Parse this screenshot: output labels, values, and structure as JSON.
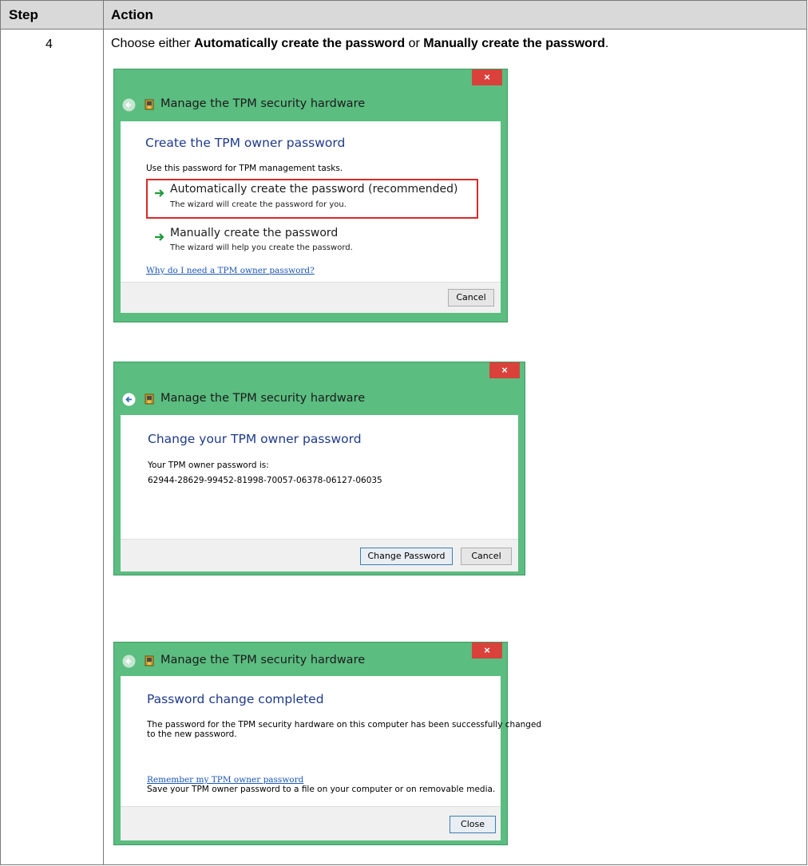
{
  "table": {
    "header_step": "Step",
    "header_action": "Action",
    "step_number": "4",
    "instruction": {
      "prefix": "Choose either ",
      "option_a": "Automatically create the password",
      "middle": " or ",
      "option_b": "Manually create the password",
      "suffix": "."
    }
  },
  "dialogs": [
    {
      "title": "Manage the TPM security hardware",
      "close_label": "×",
      "heading": "Create the TPM owner password",
      "description": "Use this password for TPM management tasks.",
      "options": [
        {
          "title": "Automatically create the password (recommended)",
          "subtitle": "The wizard will create the password for you.",
          "highlighted": true
        },
        {
          "title": "Manually create the password",
          "subtitle": "The wizard will help you create the password.",
          "highlighted": false
        }
      ],
      "help_link": "Why do I need a TPM owner password?",
      "buttons": [
        "Cancel"
      ]
    },
    {
      "title": "Manage the TPM security hardware",
      "close_label": "×",
      "heading": "Change your TPM owner password",
      "label": "Your TPM owner password is:",
      "password": "62944-28629-99452-81998-70057-06378-06127-06035",
      "buttons": [
        "Change Password",
        "Cancel"
      ]
    },
    {
      "title": "Manage the TPM security hardware",
      "close_label": "×",
      "heading": "Password change completed",
      "message_line1": "The password for the TPM security hardware on this computer has been successfully changed",
      "message_line2": "to the new password.",
      "link": "Remember my TPM owner password",
      "link_note": "Save your TPM owner password to a file on your computer or on removable media.",
      "buttons": [
        "Close"
      ]
    }
  ],
  "colors": {
    "window_frame": "#5bbd80",
    "close_button": "#d9413a",
    "highlight_box": "#d92929",
    "heading_text": "#1e3a8a",
    "link_text": "#1a55b5"
  },
  "icons": [
    "back-arrow-icon",
    "tpm-chip-icon",
    "green-arrow-icon",
    "close-icon"
  ]
}
